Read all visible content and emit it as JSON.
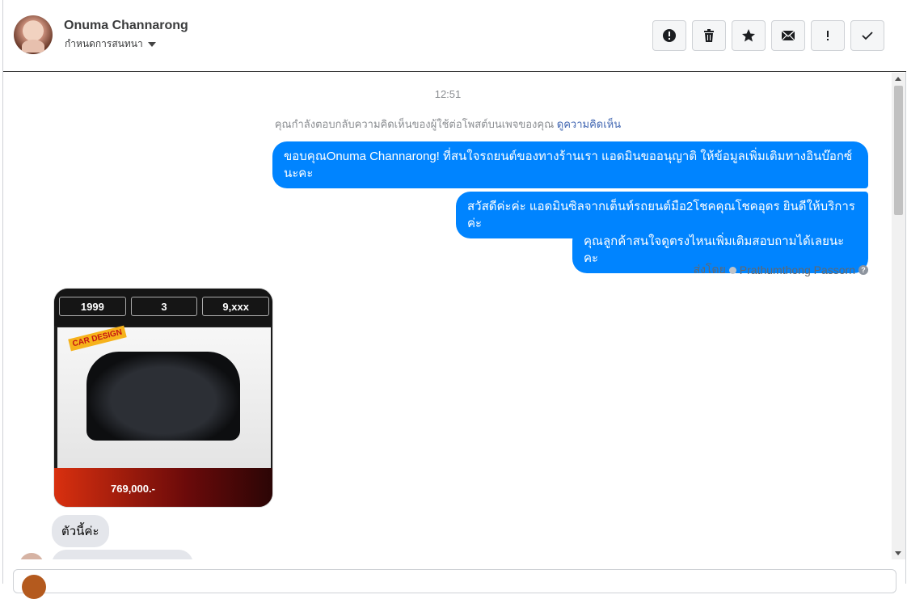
{
  "header": {
    "name": "Onuma Channarong",
    "subtitle": "กำหนดการสนทนา"
  },
  "thread": {
    "time": "12:51",
    "notice_text": "คุณกำลังตอบกลับความคิดเห็นของผู้ใช้ต่อโพสต์บนเพจของคุณ",
    "notice_link": "ดูความคิดเห็น",
    "outgoing": [
      "ขอบคุณOnuma Channarong! ที่สนใจรถยนต์ของทางร้านเรา แอดมินขออนุญาติ ให้ข้อมูลเพิ่มเติมทางอินบ๊อกซ์นะคะ",
      "สวัสดีค่ะค่ะ แอดมินซิลจากเต็นท์รถยนต์มือ2โชคคุณโชคอุดร ยินดีให้บริการค่ะ",
      "คุณลูกค้าสนใจดูตรงไหนเพิ่มเติมสอบถามได้เลยนะคะ"
    ],
    "sent_by_label": "ส่งโดย",
    "sent_by_name": "Prathumthong Passorn",
    "image": {
      "chip1": "1999",
      "chip2": "3",
      "chip3": "9,xxx",
      "badge": "CAR DESIGN",
      "price": "769,000.-"
    },
    "incoming_text": "ตัวนี้ค่ะ"
  },
  "icons": [
    "alert-icon",
    "trash-icon",
    "star-icon",
    "mail-icon",
    "exclaim-icon",
    "check-icon"
  ]
}
